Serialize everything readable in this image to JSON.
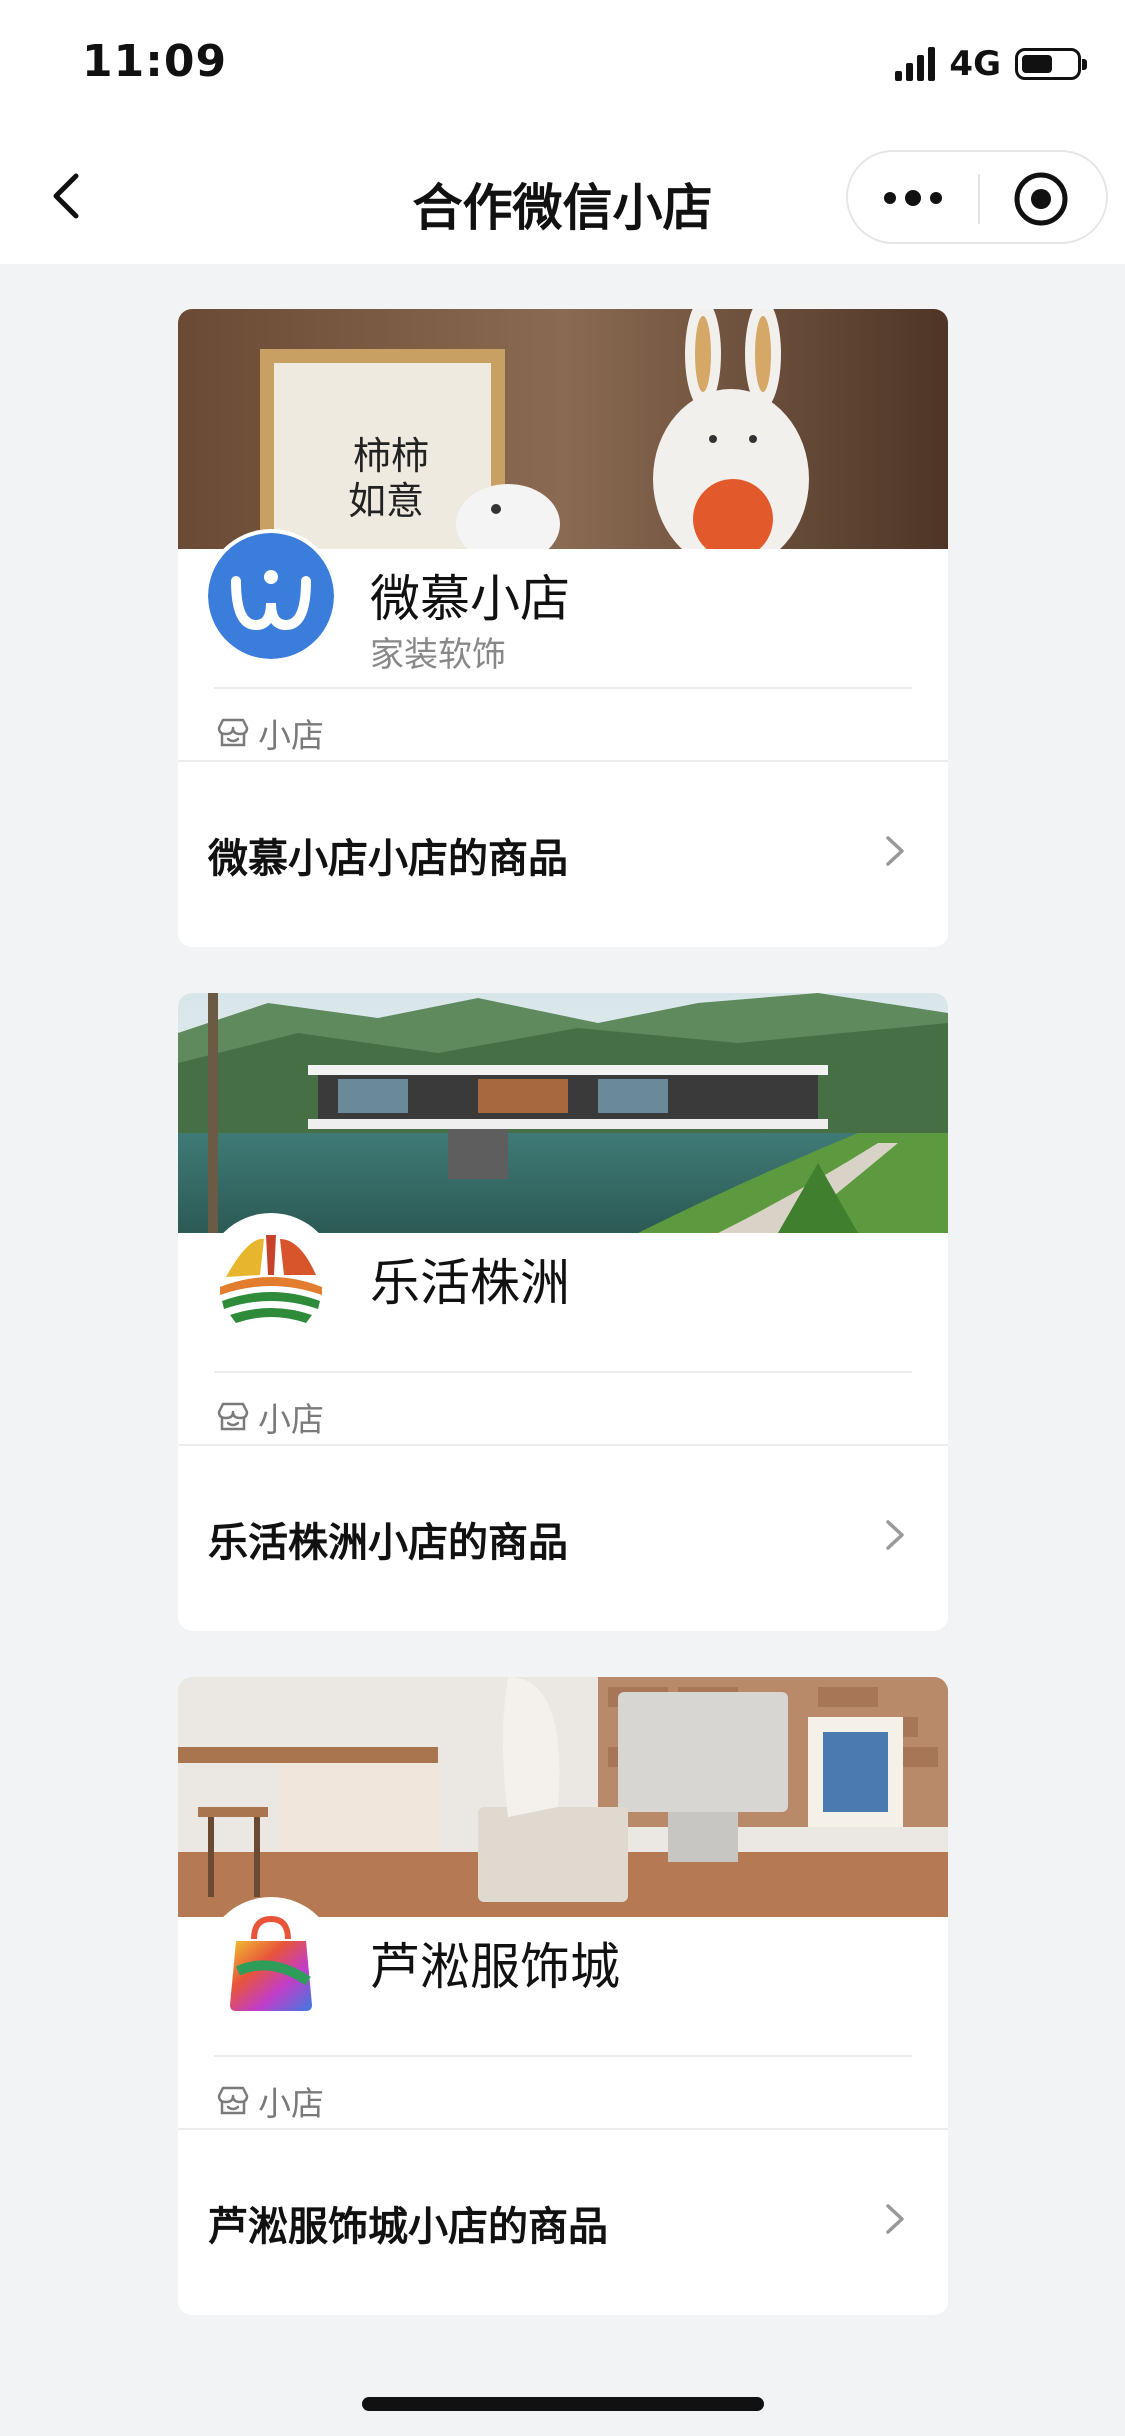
{
  "status_bar": {
    "time": "11:09",
    "network": "4G"
  },
  "nav": {
    "title": "合作微信小店"
  },
  "shops": [
    {
      "name": "微慕小店",
      "category": "家装软饰",
      "tag": "小店",
      "goods_label": "微慕小店小店的商品"
    },
    {
      "name": "乐活株洲",
      "category": "",
      "tag": "小店",
      "goods_label": "乐活株洲小店的商品"
    },
    {
      "name": "芦淞服饰城",
      "category": "",
      "tag": "小店",
      "goods_label": "芦淞服饰城小店的商品"
    }
  ],
  "icons": {
    "back": "chevron-left-icon",
    "more": "more-dots-icon",
    "close": "target-close-icon",
    "shop_tag": "shop-awning-icon",
    "row_arrow": "chevron-right-icon"
  },
  "colors": {
    "weimu_brand": "#3b7ddb",
    "page_bg": "#f2f3f5"
  }
}
